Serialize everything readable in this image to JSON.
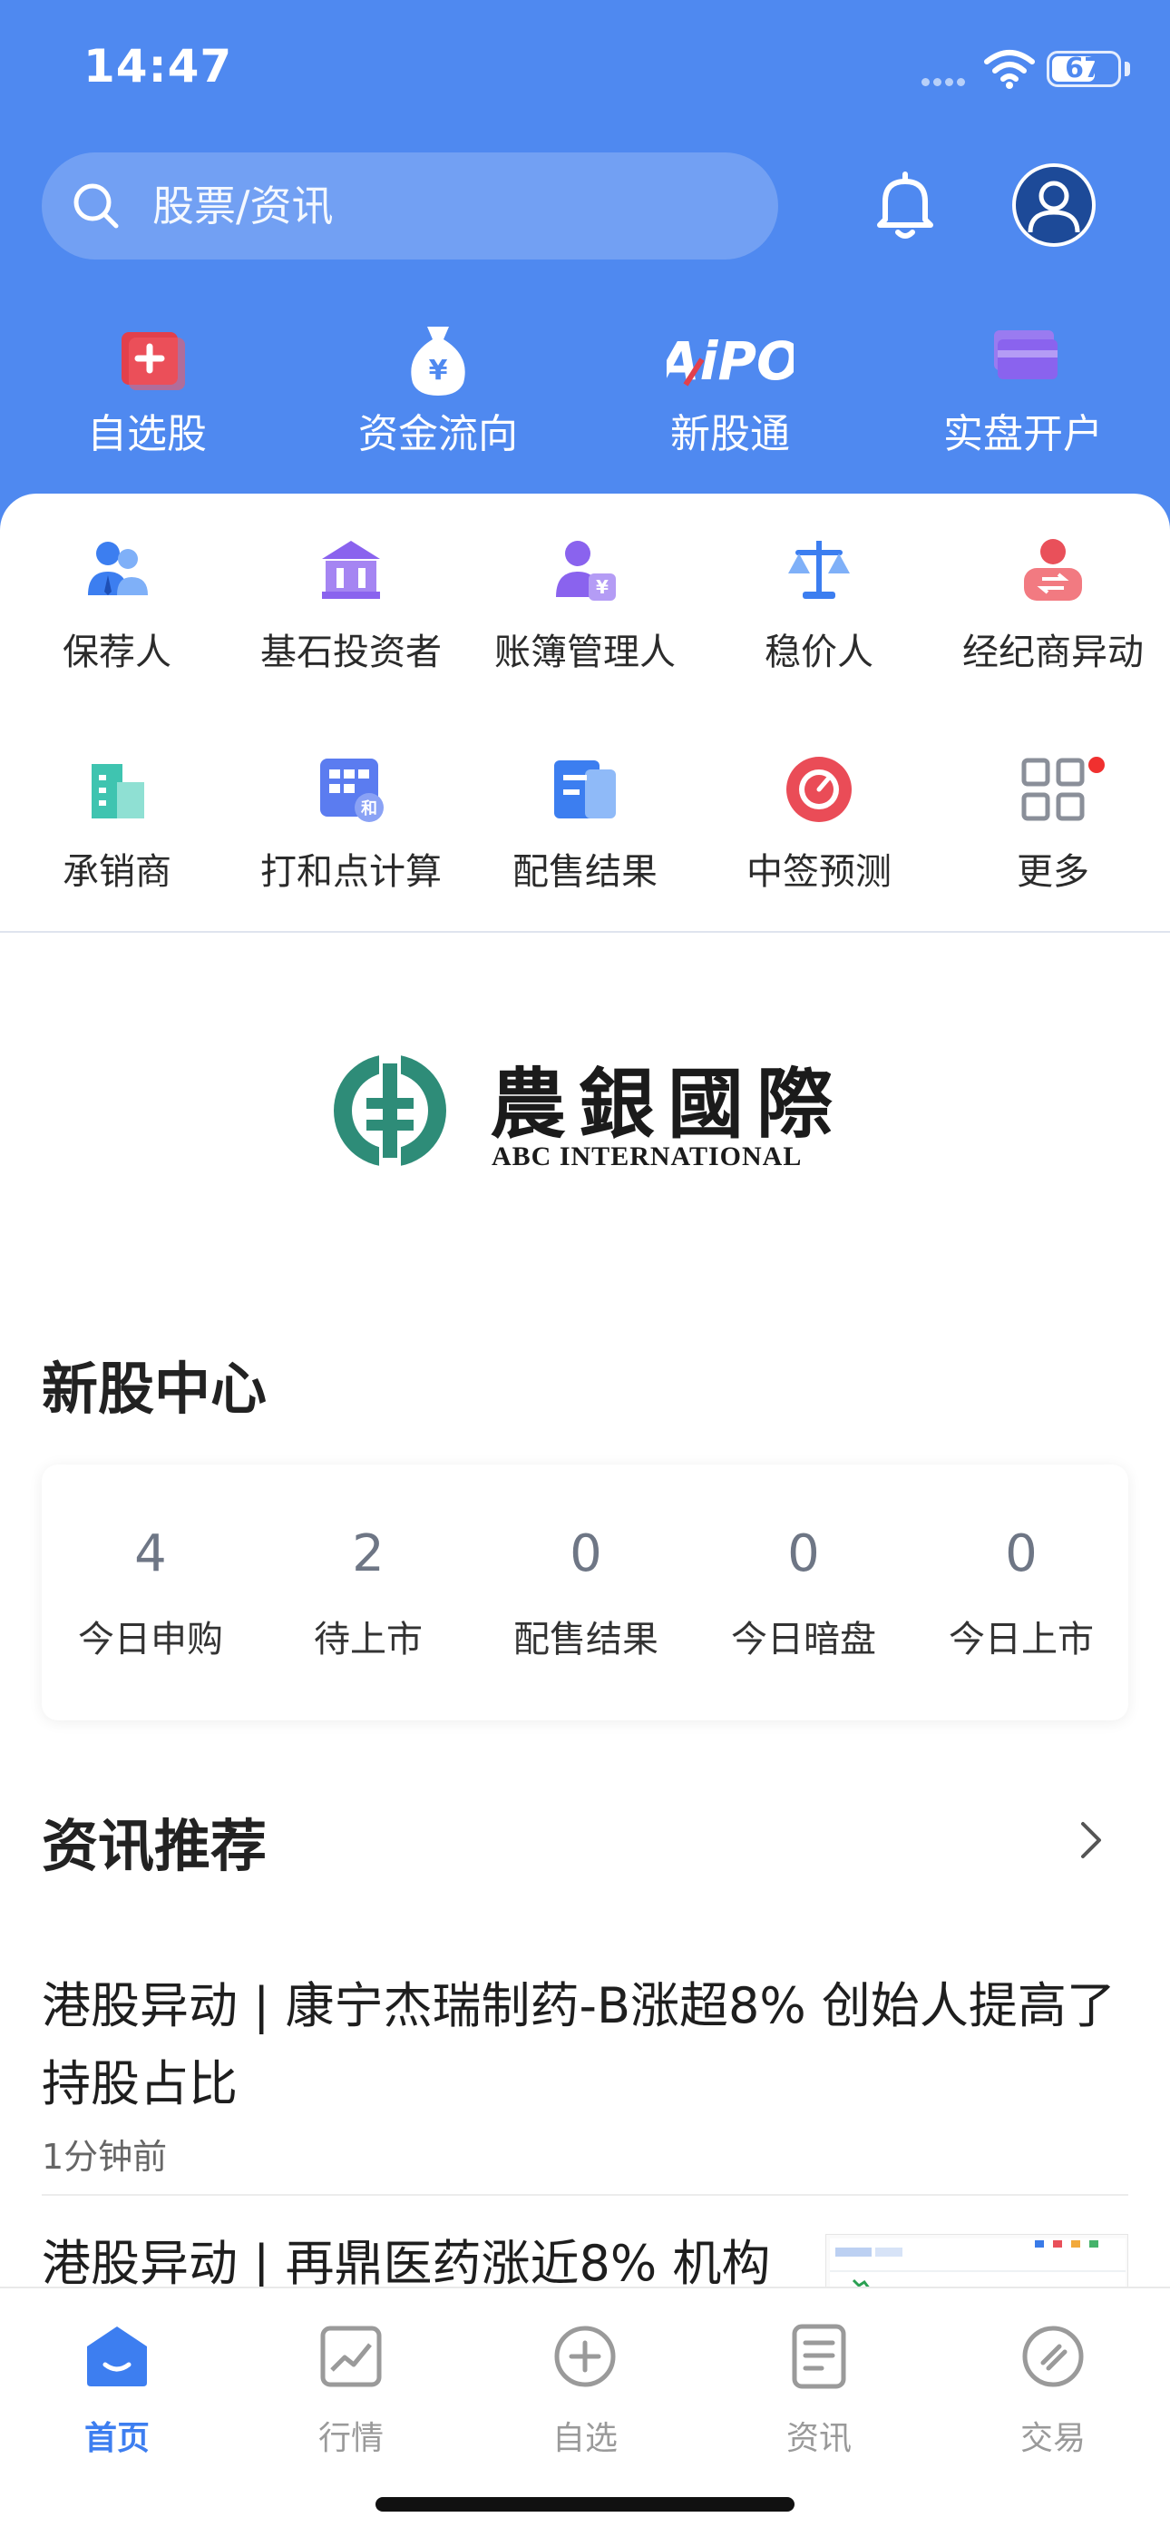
{
  "status_bar": {
    "time": "14:47",
    "battery": "67",
    "battery_level": 0.67
  },
  "search": {
    "placeholder": "股票/资讯"
  },
  "top_nav": [
    {
      "label": "自选股",
      "icon": "watchlist-plus-icon"
    },
    {
      "label": "资金流向",
      "icon": "money-bag-icon"
    },
    {
      "label": "新股通",
      "icon": "aipo-logo",
      "logo_text": "AiPO"
    },
    {
      "label": "实盘开户",
      "icon": "card-stack-icon"
    }
  ],
  "grid": [
    {
      "label": "保荐人",
      "icon": "sponsor-icon"
    },
    {
      "label": "基石投资者",
      "icon": "bank-building-icon"
    },
    {
      "label": "账簿管理人",
      "icon": "bookrunner-icon"
    },
    {
      "label": "稳价人",
      "icon": "scale-icon"
    },
    {
      "label": "经纪商异动",
      "icon": "broker-exchange-icon"
    },
    {
      "label": "承销商",
      "icon": "buildings-icon"
    },
    {
      "label": "打和点计算",
      "icon": "calculator-icon"
    },
    {
      "label": "配售结果",
      "icon": "document-icon"
    },
    {
      "label": "中签预测",
      "icon": "gauge-icon"
    },
    {
      "label": "更多",
      "icon": "grid-more-icon"
    }
  ],
  "banner": {
    "name_cn": "農銀國際",
    "name_en": "ABC INTERNATIONAL"
  },
  "ipo_center": {
    "title": "新股中心",
    "stats": [
      {
        "value": "4",
        "label": "今日申购"
      },
      {
        "value": "2",
        "label": "待上市"
      },
      {
        "value": "0",
        "label": "配售结果"
      },
      {
        "value": "0",
        "label": "今日暗盘"
      },
      {
        "value": "0",
        "label": "今日上市"
      }
    ]
  },
  "news": {
    "title": "资讯推荐",
    "items": [
      {
        "title": "港股异动 | 康宁杰瑞制药-B涨超8% 创始人提高了持股占比",
        "time": "1分钟前"
      },
      {
        "title": "港股异动 | 再鼎医药涨近8% 机构",
        "time": ""
      }
    ]
  },
  "tabbar": [
    {
      "label": "首页",
      "icon": "home-icon",
      "active": true
    },
    {
      "label": "行情",
      "icon": "market-chart-icon",
      "active": false
    },
    {
      "label": "自选",
      "icon": "add-circle-icon",
      "active": false
    },
    {
      "label": "资讯",
      "icon": "news-icon",
      "active": false
    },
    {
      "label": "交易",
      "icon": "trade-icon",
      "active": false
    }
  ],
  "colors": {
    "brand_blue": "#4f89f0",
    "tab_active": "#3d7ef0",
    "badge_red": "#f0302f"
  }
}
